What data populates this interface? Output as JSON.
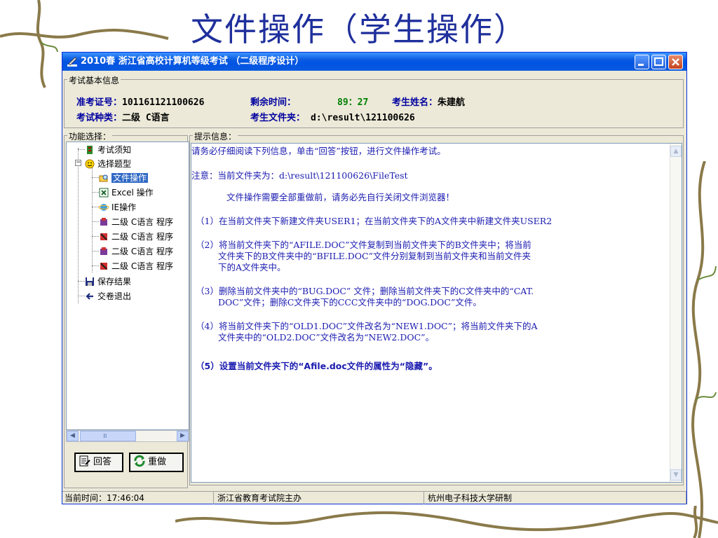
{
  "slide": {
    "title": "文件操作（学生操作）"
  },
  "window": {
    "title": "2010春 浙江省高校计算机等级考试 （二级程序设计）",
    "buttons": {
      "minimize": "minimize",
      "maximize": "maximize",
      "close": "close"
    }
  },
  "exam_info": {
    "group_label": "考试基本信息",
    "exam_no_label": "准考证号：",
    "exam_no": "101161121100626",
    "time_left_label": "剩余时间：",
    "time_left": "89：27",
    "name_label": "考生姓名：",
    "name": "朱建航",
    "type_label": "考试种类：",
    "type": "二级 C语言",
    "folder_label": "考生文件夹：",
    "folder": "d:\\result\\121100626"
  },
  "function_panel": {
    "group_label": "功能选择：",
    "tree": [
      {
        "label": "考试须知",
        "icon": "exam-notice-icon"
      },
      {
        "label": "选择题型",
        "icon": "smiley-icon"
      },
      {
        "label": "文件操作",
        "icon": "search-folder-icon",
        "selected": true
      },
      {
        "label": "Excel 操作",
        "icon": "excel-icon"
      },
      {
        "label": "IE操作",
        "icon": "ie-icon"
      },
      {
        "label": "二级 C语言 程序",
        "icon": "program-blue-icon"
      },
      {
        "label": "二级 C语言 程序",
        "icon": "program-red-icon"
      },
      {
        "label": "二级 C语言 程序",
        "icon": "program-blue-icon"
      },
      {
        "label": "二级 C语言 程序",
        "icon": "program-red-icon"
      },
      {
        "label": "保存结果",
        "icon": "save-icon"
      },
      {
        "label": "交卷退出",
        "icon": "exit-arrow-icon"
      }
    ],
    "scroll_mid": "Ⅲ",
    "answer_button": "回答",
    "redo_button": "重做"
  },
  "prompt_panel": {
    "group_label": "提示信息：",
    "lines": [
      "请务必仔细阅读下列信息，单击“回答”按钮，进行文件操作考试。",
      "注意：当前文件夹为：d:\\result\\121100626\\FileTest",
      "文件操作需要全部重做前，请务必先自行关闭文件浏览器！",
      "（1）在当前文件夹下新建文件夹USER1；在当前文件夹下的A文件夹中新建文件夹USER2",
      "（2）将当前文件夹下的“AFILE.DOC”文件复制到当前文件夹下的B文件夹中；将当前",
      "文件夹下的B文件夹中的“BFILE.DOC”文件分别复制到当前文件夹和当前文件夹",
      "下的A文件夹中。",
      "（3）删除当前文件夹中的“BUG.DOC” 文件；删除当前文件夹下的C文件夹中的“CAT.",
      "DOC”文件；删除C文件夹下的CCC文件夹中的“DOG.DOC”文件。",
      "（4）将当前文件夹下的“OLD1.DOC”文件改名为“NEW1.DOC”；将当前文件夹下的A",
      "文件夹中的“OLD2.DOC”文件改名为“NEW2.DOC”。",
      "（5）设置当前文件夹下的“Afile.doc文件的属性为“隐藏”。"
    ]
  },
  "statusbar": {
    "time": "当前时间：17:46:04",
    "org": "浙江省教育考试院主办",
    "dev": "杭州电子科技大学研制"
  }
}
